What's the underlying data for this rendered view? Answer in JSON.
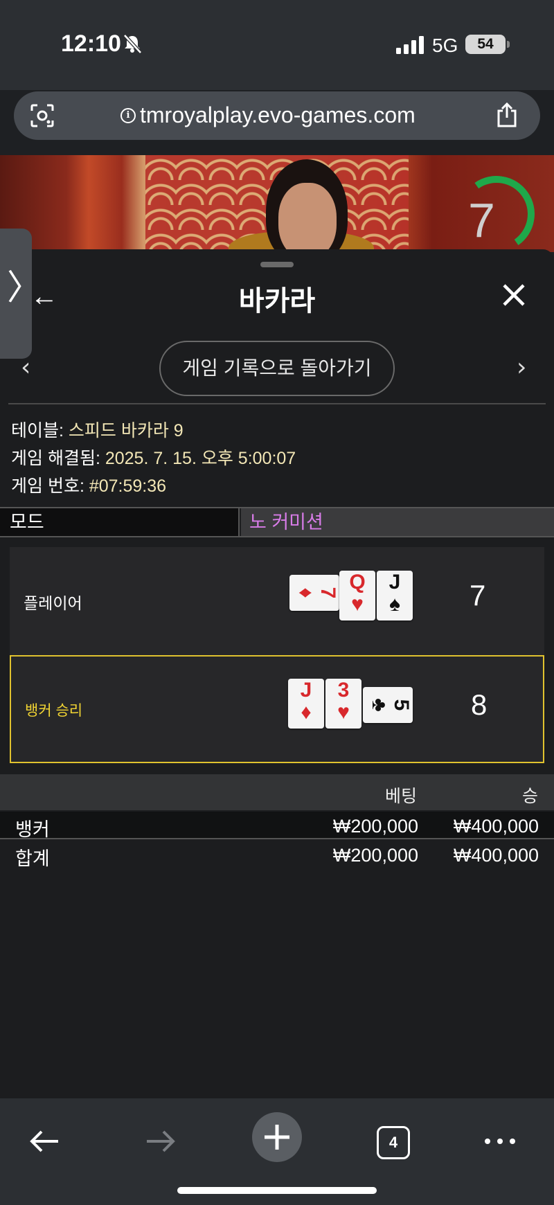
{
  "status_bar": {
    "time": "12:10",
    "network": "5G",
    "battery": "54"
  },
  "browser": {
    "url": "tmroyalplay.evo-games.com",
    "tab_count": "4"
  },
  "video": {
    "timer": "7"
  },
  "panel": {
    "title": "바카라",
    "history_button": "게임 기록으로 돌아가기",
    "table_label": "테이블: ",
    "table_value": "스피드 바카라 9",
    "resolved_label": "게임 해결됨: ",
    "resolved_value": "2025. 7. 15. 오후 5:00:07",
    "game_number_label": "게임 번호: ",
    "game_number_value": "#07:59:36",
    "mode_label": "모드",
    "mode_value": "노 커미션"
  },
  "hands": {
    "player": {
      "label": "플레이어",
      "score": "7",
      "cards": [
        {
          "rank": "7",
          "suit": "♦",
          "color": "red",
          "sideways": true
        },
        {
          "rank": "Q",
          "suit": "♥",
          "color": "red",
          "sideways": false
        },
        {
          "rank": "J",
          "suit": "♠",
          "color": "black",
          "sideways": false
        }
      ]
    },
    "banker": {
      "label": "뱅커 승리",
      "score": "8",
      "cards": [
        {
          "rank": "J",
          "suit": "♦",
          "color": "red",
          "sideways": false
        },
        {
          "rank": "3",
          "suit": "♥",
          "color": "red",
          "sideways": false
        },
        {
          "rank": "5",
          "suit": "♣",
          "color": "black",
          "sideways": true
        }
      ]
    }
  },
  "bets": {
    "headers": {
      "bet": "베팅",
      "win": "승"
    },
    "rows": [
      {
        "name": "뱅커",
        "bet": "₩200,000",
        "win": "₩400,000"
      },
      {
        "name": "합계",
        "bet": "₩200,000",
        "win": "₩400,000"
      }
    ]
  },
  "colors": {
    "winner_border": "#e0c22e",
    "mode_value": "#d87ce8",
    "timer_ring": "#1fa84a"
  }
}
